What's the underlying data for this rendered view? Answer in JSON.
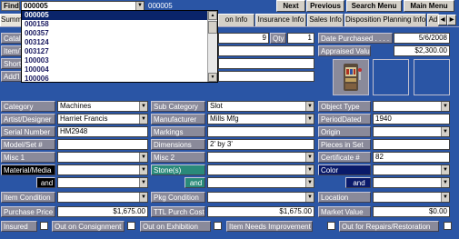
{
  "find": {
    "label": "Find",
    "value": "000005",
    "code": "000005"
  },
  "nav": {
    "next": "Next",
    "previous": "Previous",
    "search": "Search Menu",
    "main": "Main Menu"
  },
  "tabs": [
    "Summ",
    "on Info",
    "Insurance Info",
    "Sales Info",
    "Disposition Planning Info",
    "Ad"
  ],
  "dropdown_items": [
    "000005",
    "000158",
    "000357",
    "003124",
    "003127",
    "100003",
    "100004",
    "100006"
  ],
  "left_labels": [
    "Catal",
    "Item/T",
    "Short I",
    "Add'l D"
  ],
  "qty": {
    "num": "9",
    "label": "Qty",
    "value": "1"
  },
  "date_purchased": {
    "label": "Date Purchased . . . .",
    "value": "5/6/2008"
  },
  "appraised": {
    "label": "Appraised Value",
    "value": "$2,300.00"
  },
  "category": {
    "label": "Category",
    "value": "Machines"
  },
  "sub_category": {
    "label": "Sub Category",
    "value": "Slot"
  },
  "object_type": {
    "label": "Object Type",
    "value": ""
  },
  "artist": {
    "label": "Artist/Designer",
    "value": "Harriet Francis"
  },
  "manufacturer": {
    "label": "Manufacturer",
    "value": "Mills Mfg"
  },
  "period_date": {
    "label": "PeriodDated",
    "value": "1940"
  },
  "serial": {
    "label": "Serial Number",
    "value": "HM2948"
  },
  "markings": {
    "label": "Markings",
    "value": ""
  },
  "origin": {
    "label": "Origin",
    "value": ""
  },
  "model": {
    "label": "Model/Set #",
    "value": ""
  },
  "dimensions": {
    "label": "Dimensions",
    "value": "2' by 3'"
  },
  "pieces": {
    "label": "Pieces in Set",
    "value": ""
  },
  "misc1": {
    "label": "Misc 1",
    "value": ""
  },
  "misc2": {
    "label": "Misc 2",
    "value": ""
  },
  "certificate": {
    "label": "Certificate #",
    "value": "82"
  },
  "material": {
    "label": "Material/Media",
    "value": "",
    "and": "and"
  },
  "stones": {
    "label": "Stone(s)",
    "value": "",
    "and": "and"
  },
  "color": {
    "label": "Color",
    "value": "",
    "and": "and"
  },
  "item_condition": {
    "label": "Item Condition",
    "value": ""
  },
  "pkg_condition": {
    "label": "Pkg Condition",
    "value": ""
  },
  "location": {
    "label": "Location",
    "value": ""
  },
  "purchase_price": {
    "label": "Purchase Price",
    "value": "$1,675.00"
  },
  "ttl_purch_cost": {
    "label": "TTL Purch Cost",
    "value": "$1,675.00"
  },
  "market_value": {
    "label": "Market Value",
    "value": "$0.00"
  },
  "checks": {
    "insured": "Insured",
    "consignment": "Out on Consignment",
    "exhibition": "Out on Exhibition",
    "improvement": "Item Needs Improvement",
    "repairs": "Out for Repairs/Restoration"
  }
}
